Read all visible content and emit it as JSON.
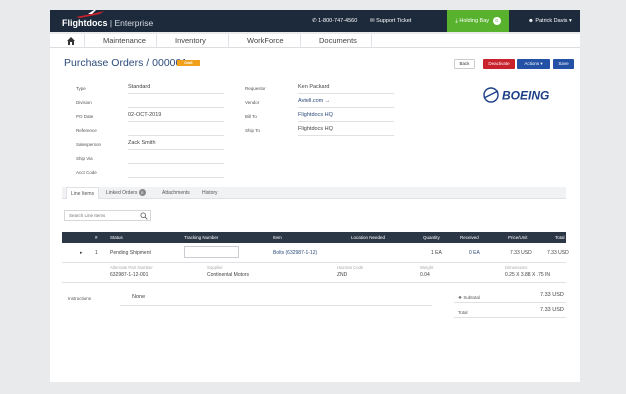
{
  "app": {
    "logo_brand": "Flightdocs",
    "logo_suffix": "Enterprise",
    "phone": "1-800-747-4560",
    "support": "Support Ticket",
    "holding_label": "Holding Bay",
    "holding_count": "0",
    "user_name": "Patrick Davis"
  },
  "nav": [
    "Maintenance",
    "Inventory",
    "WorkForce",
    "Documents"
  ],
  "page": {
    "title": "Purchase Orders",
    "separator": "/",
    "number": "000001",
    "status_badge": "Draft",
    "buttons": {
      "back": "Back",
      "deactivate": "Deactivate",
      "actions": "Actions ▾",
      "save": "Save"
    },
    "brand_logo_text": "BOEING"
  },
  "fields_left": [
    {
      "label": "Type",
      "value": "Standard"
    },
    {
      "label": "Division",
      "value": ""
    },
    {
      "label": "PO Date",
      "value": "02-OCT-2019"
    },
    {
      "label": "Reference",
      "value": ""
    },
    {
      "label": "Salesperson",
      "value": "Zack Smith"
    },
    {
      "label": "Ship Via",
      "value": ""
    },
    {
      "label": "Acct Code",
      "value": ""
    }
  ],
  "fields_right": [
    {
      "label": "Requestor",
      "value": "Ken Packard"
    },
    {
      "label": "Vendor",
      "value": "Avtell.com →"
    },
    {
      "label": "Bill To",
      "value": "Flightdocs HQ"
    },
    {
      "label": "Ship To",
      "value": "Flightdocs HQ"
    }
  ],
  "tabs": {
    "line_items": "Line Items",
    "linked_orders": "Linked Orders",
    "linked_count": "0",
    "attachments": "Attachments",
    "history": "History"
  },
  "search": {
    "placeholder": "Search Line Items"
  },
  "table": {
    "headers": {
      "num": "#",
      "status": "Status",
      "tracking": "Tracking Number",
      "item": "Item",
      "location": "Location Needed",
      "quantity": "Quantity",
      "received": "Received",
      "price": "Price/Unit",
      "total": "Total"
    },
    "row": {
      "expand": "▸",
      "num": "1",
      "status": "Pending Shipment",
      "item": "Bolts (632987-1-12)",
      "quantity": "1 EA",
      "received": "0 EA",
      "price": "7.33 USD",
      "total": "7.33 USD"
    },
    "detail": {
      "alt_part_label": "Alternate Part Number",
      "alt_part": "632987-1-12-001",
      "supplier_label": "Supplier",
      "supplier": "Continental Motors",
      "hazmat_label": "Hazmat Code",
      "hazmat": "ZND",
      "weight_label": "Weight",
      "weight": "0.04",
      "dims_label": "Dimensions",
      "dims": "0.25 X 3.88 X .75 IN"
    }
  },
  "instructions": {
    "label": "Instructions",
    "value": "None"
  },
  "totals": {
    "subtotal_label": "Subtotal",
    "subtotal": "7.33 USD",
    "total_label": "Total",
    "total": "7.33 USD"
  }
}
